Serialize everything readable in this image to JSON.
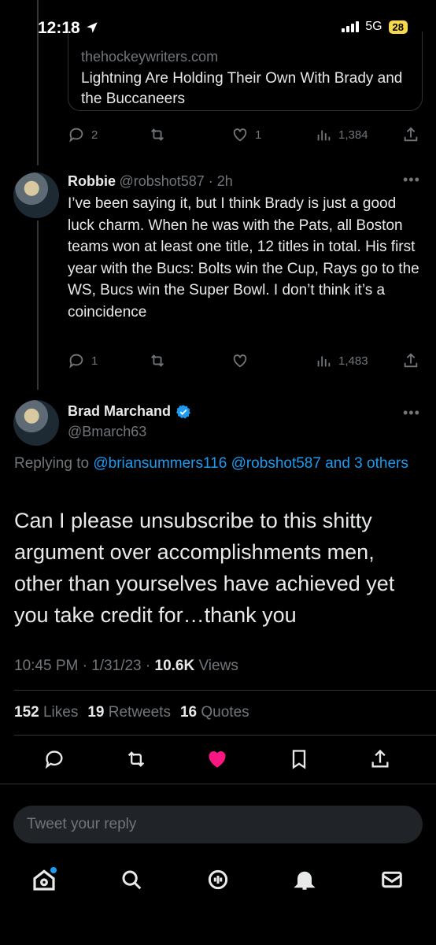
{
  "status": {
    "time": "12:18",
    "network": "5G",
    "battery": "28"
  },
  "link_card": {
    "domain": "thehockeywriters.com",
    "title": "Lightning Are Holding Their Own With Brady and the Buccaneers"
  },
  "tweet1_actions": {
    "replies": "2",
    "likes": "1",
    "views": "1,384"
  },
  "tweet2": {
    "name": "Robbie",
    "handle": "@robshot587 · 2h",
    "text": "I’ve been saying it, but I think Brady is just a good luck charm. When he was with the Pats, all Boston teams won at least one title, 12 titles in total. His first year with the Bucs: Bolts win the Cup, Rays go to the WS, Bucs win the Super Bowl. I don’t think it’s a coincidence",
    "replies": "1",
    "views": "1,483"
  },
  "main_tweet": {
    "name": "Brad Marchand",
    "handle": "@Bmarch63",
    "replying_prefix": "Replying to ",
    "replying_to": "@briansummers116 @robshot587 and 3 others",
    "text": "Can I please unsubscribe to this shitty argument over accomplishments men, other than yourselves have achieved yet you take credit for…thank you",
    "time": "10:45 PM · 1/31/23 · ",
    "views_count": "10.6K",
    "views_label": " Views",
    "likes_count": "152",
    "likes_label": " Likes",
    "retweets_count": "19",
    "retweets_label": " Retweets",
    "quotes_count": "16",
    "quotes_label": " Quotes"
  },
  "composer": {
    "placeholder": "Tweet your reply"
  },
  "colors": {
    "accent": "#1d9bf0",
    "like": "#f91880",
    "muted": "#71767b"
  }
}
